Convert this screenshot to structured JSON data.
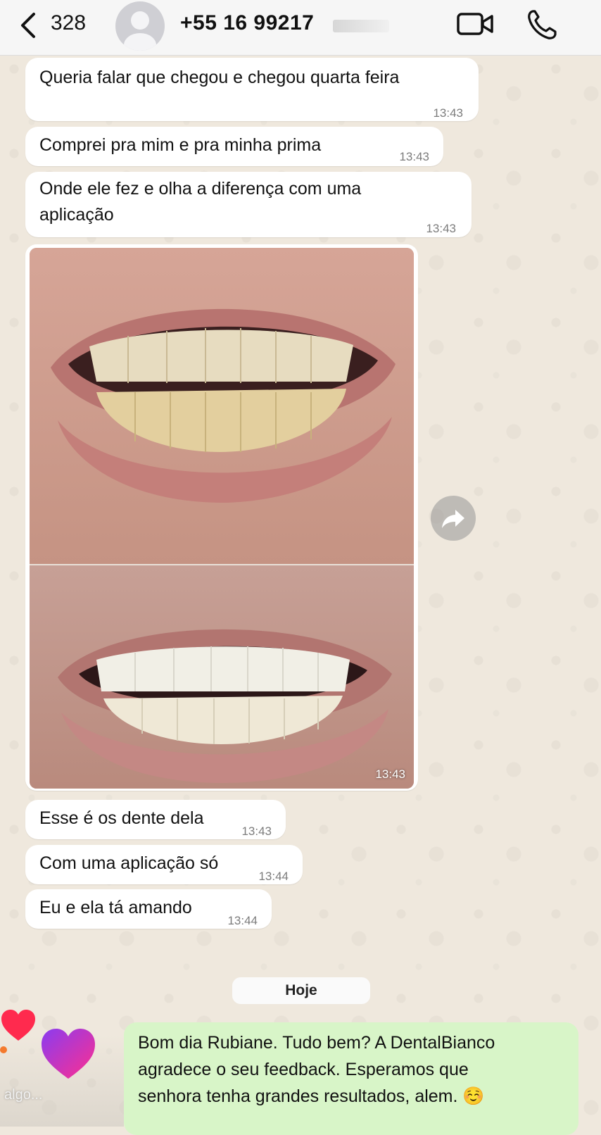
{
  "header": {
    "back_count": "328",
    "contact_number": "+55 16 99217",
    "icons": [
      "chevron-left-icon",
      "avatar-placeholder-icon",
      "video-camera-icon",
      "phone-icon"
    ]
  },
  "messages": [
    {
      "text": "Queria falar que chegou e chegou quarta feira",
      "time": "13:43"
    },
    {
      "text": "Comprei pra mim e pra minha prima",
      "time": "13:43"
    },
    {
      "text_line1": "Onde ele fez e olha a diferença com uma",
      "text_line2": "aplicação",
      "time": "13:43"
    },
    {
      "type": "image",
      "time": "13:43"
    },
    {
      "text": "Esse é os dente dela",
      "time": "13:43"
    },
    {
      "text": "Com uma aplicação só",
      "time": "13:44"
    },
    {
      "text": "Eu e ela tá amando",
      "time": "13:44"
    }
  ],
  "date_separator": "Hoje",
  "outgoing": {
    "line1": "Bom dia Rubiane. Tudo bem? A DentalBianco",
    "line2": "agradece o seu feedback. Esperamos que",
    "line3": "senhora tenha grandes resultados, alem. ☺️"
  },
  "overlay": {
    "comment_hint": "algo...",
    "colors": {
      "heart_small": "#ff2a4e",
      "heart_big_start": "#8a3cf0",
      "heart_big_end": "#ff2f8e"
    }
  },
  "colors": {
    "chat_background": "#efe8dd",
    "incoming_bubble": "#ffffff",
    "outgoing_bubble": "#d8f5c8",
    "timestamp": "#7c7c7c"
  }
}
